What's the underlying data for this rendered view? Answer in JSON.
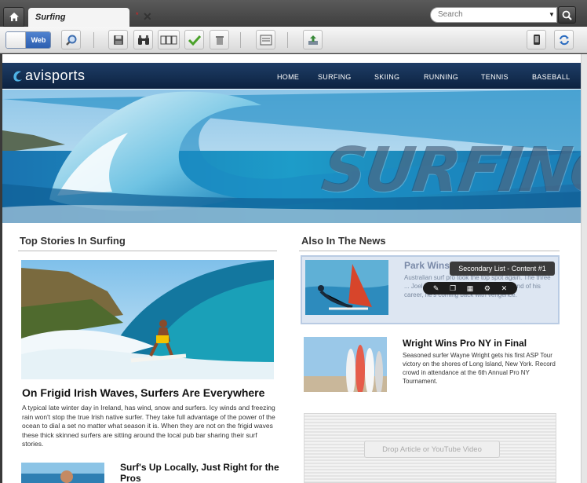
{
  "tab": {
    "title": "Surfing",
    "dirty_marker": "*"
  },
  "search": {
    "placeholder": "Search"
  },
  "toolbar": {
    "view_toggle_label": "Web"
  },
  "site": {
    "logo_text": "avisports",
    "nav": [
      "HOME",
      "SURFING",
      "SKIING",
      "RUNNING",
      "TENNIS",
      "BASEBALL"
    ],
    "hero_word": "SURFING"
  },
  "top_stories": {
    "title": "Top Stories In Surfing",
    "headline": "On Frigid Irish Waves, Surfers Are Everywhere",
    "body": "A typical late winter day in Ireland, has wind, snow and surfers. Icy winds and freezing rain won't stop the true Irish native surfer. They take full advantage of the power of the ocean to dial a set no matter what season it is. When they are not on the frigid waves these thick skinned surfers are sitting around the local pub bar sharing their surf stories.",
    "sub_headline": "Surf's Up Locally, Just Right for the Pros"
  },
  "news": {
    "title": "Also In The News",
    "items": [
      {
        "headline": "Park Wins",
        "body": "Australian surf pro took the top spot again. The three ... Joel Park. Once thought to be at the end of his career, he's coming back with vengence."
      },
      {
        "headline": "Wright Wins Pro NY in Final",
        "body": "Seasoned surfer Wayne Wright gets his first ASP Tour victory on the shores of Long Island, New York. Record crowd in attendance at the 6th Annual Pro NY Tournament."
      }
    ],
    "tooltip": "Secondary List - Content #1",
    "drop_label": "Drop Article or YouTube Video"
  }
}
